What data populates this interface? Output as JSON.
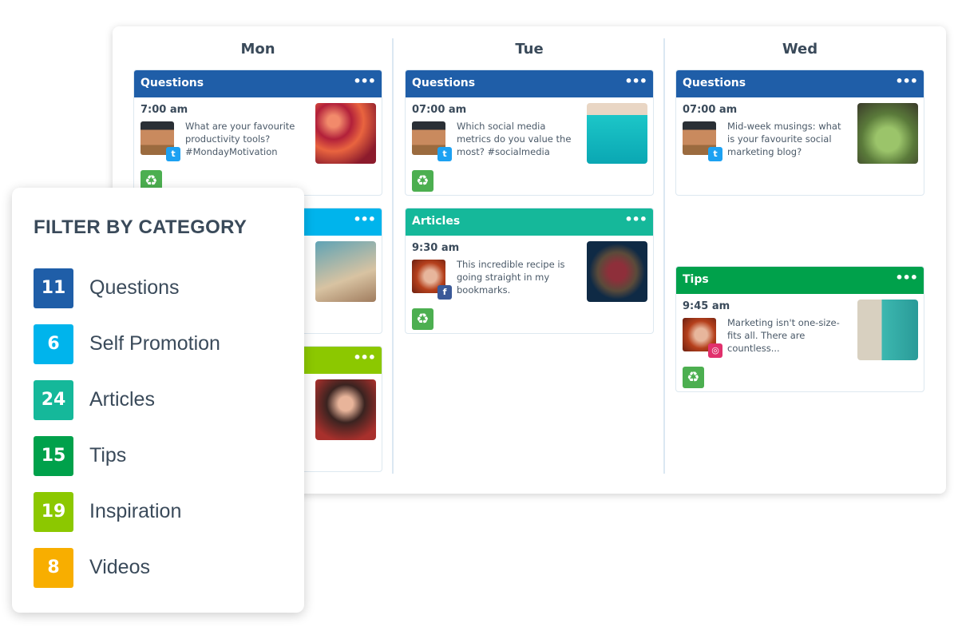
{
  "days": [
    "Mon",
    "Tue",
    "Wed"
  ],
  "colors": {
    "Questions": "#1f5ea8",
    "Self Promotion": "#00b4ec",
    "Articles": "#15b89a",
    "Tips": "#00a14b",
    "Inspiration": "#8cc800",
    "Videos": "#f8ae00"
  },
  "cards": [
    {
      "category": "Questions",
      "time": "7:00 am",
      "text": "What are your favourite productivity tools? #MondayMotivation",
      "social": "twitter"
    },
    {
      "category": "Questions",
      "time": "07:00 am",
      "text": "Which social media metrics do you value the most? #socialmedia",
      "social": "twitter"
    },
    {
      "category": "Articles",
      "time": "9:30 am",
      "text": "This incredible recipe is going straight in my bookmarks.",
      "social": "facebook"
    },
    {
      "category": "Questions",
      "time": "07:00 am",
      "text": "Mid-week musings: what is your favourite social marketing blog?",
      "social": "twitter"
    },
    {
      "category": "Tips",
      "time": "9:45 am",
      "text": "Marketing isn't one-size-fits all. There are countless...",
      "social": "instagram"
    }
  ],
  "more_label": "•••",
  "filter": {
    "title": "FILTER BY CATEGORY",
    "items": [
      {
        "count": "11",
        "label": "Questions",
        "color": "#1f5ea8"
      },
      {
        "count": "6",
        "label": "Self Promotion",
        "color": "#00b4ec"
      },
      {
        "count": "24",
        "label": "Articles",
        "color": "#15b89a"
      },
      {
        "count": "15",
        "label": "Tips",
        "color": "#00a14b"
      },
      {
        "count": "19",
        "label": "Inspiration",
        "color": "#8cc800"
      },
      {
        "count": "8",
        "label": "Videos",
        "color": "#f8ae00"
      }
    ]
  }
}
